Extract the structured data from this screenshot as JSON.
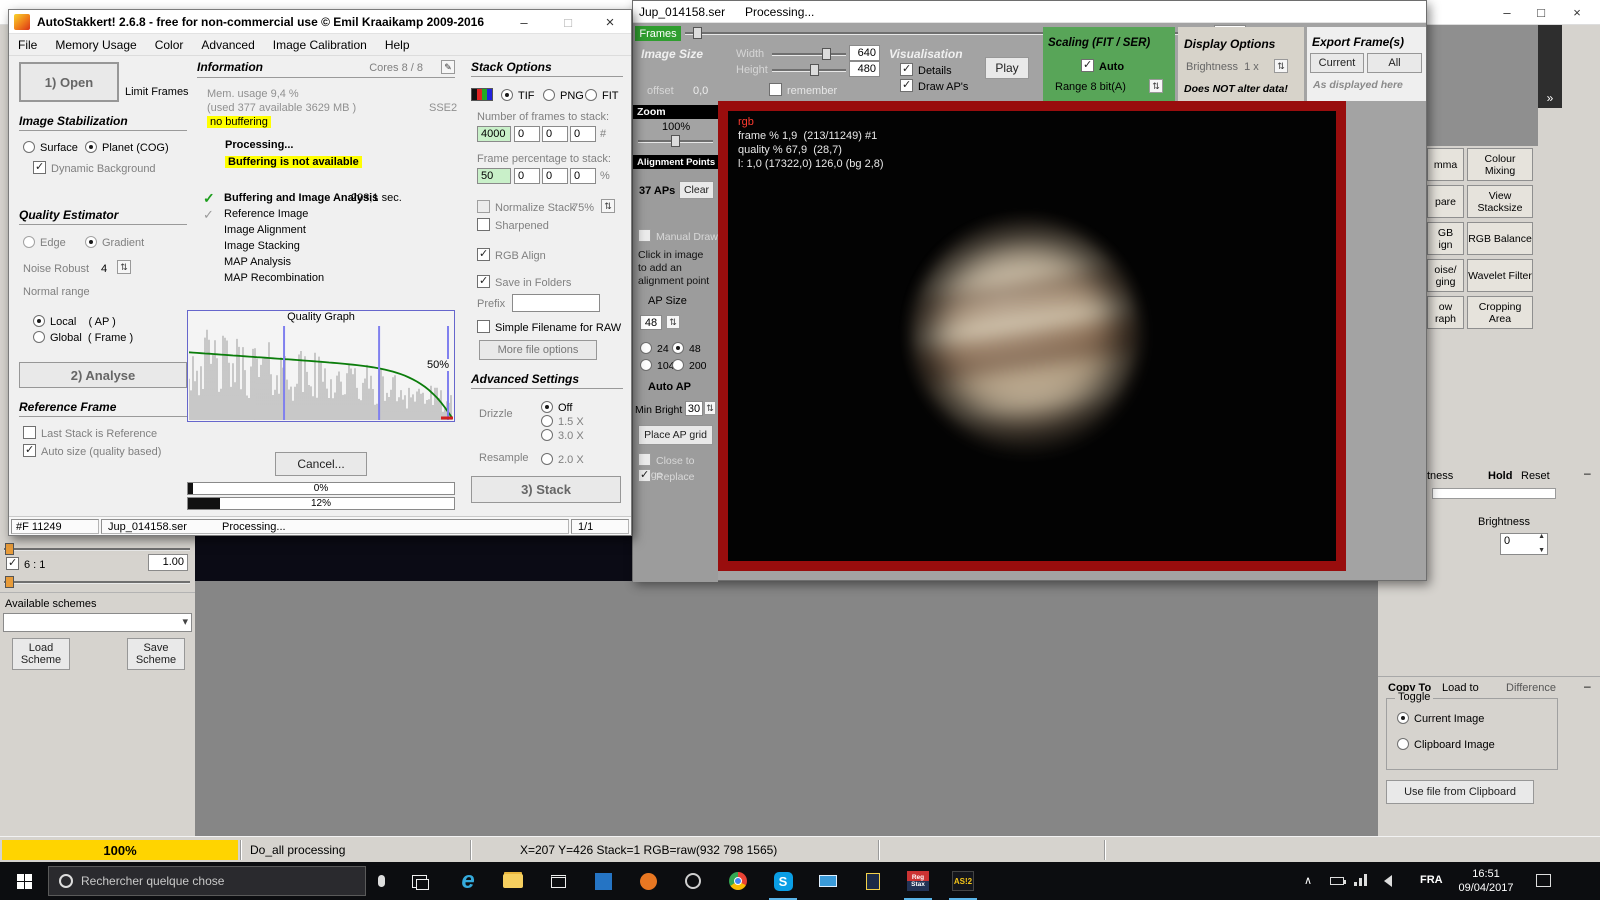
{
  "icons": {
    "minimize": "–",
    "maximize": "□",
    "close": "×",
    "chevron_right": "»",
    "dropdown_arrow": "▾",
    "updown": "⇅",
    "pencil": "✎",
    "tray_chevron": "∧",
    "check": "✓"
  },
  "main_window": {
    "title": "AutoStakkert! 2.6.8 - free for non-commercial use © Emil Kraaikamp 2009-2016",
    "menus": [
      "File",
      "Memory Usage",
      "Color",
      "Advanced",
      "Image Calibration",
      "Help"
    ],
    "open_button": "1) Open",
    "limit_frames": "Limit Frames",
    "stabilization": {
      "title": "Image Stabilization",
      "surface": "Surface",
      "planet": "Planet (COG)",
      "dynamic_background": "Dynamic Background"
    },
    "quality": {
      "title": "Quality Estimator",
      "edge": "Edge",
      "gradient": "Gradient",
      "noise_robust": "Noise Robust",
      "noise_value": "4",
      "normal_range": "Normal range",
      "local": "Local    ( AP )",
      "global": "Global  ( Frame )"
    },
    "analyse_button": "2) Analyse",
    "reference": {
      "title": "Reference Frame",
      "last_stack": "Last Stack is Reference",
      "auto_size": "Auto size (quality based)"
    },
    "info": {
      "title": "Information",
      "cores": "Cores 8 / 8",
      "mem1": "Mem. usage 9,4 %",
      "mem2": "(used 377 available 3629 MB )",
      "sse": "SSE2",
      "nobuf": "no buffering",
      "processing": "Processing...",
      "bufna": "Buffering is not available",
      "steps": [
        {
          "label": "Buffering and Image Analysis",
          "time": "203,1 sec."
        },
        {
          "label": "Reference Image",
          "time": ""
        },
        {
          "label": "Image Alignment",
          "time": ""
        },
        {
          "label": "Image Stacking",
          "time": ""
        },
        {
          "label": "MAP Analysis",
          "time": ""
        },
        {
          "label": "MAP Recombination",
          "time": ""
        }
      ],
      "graph_title": "Quality Graph",
      "graph_pct": "50%",
      "cancel": "Cancel...",
      "p1": "0%",
      "p2": "12%"
    },
    "status": {
      "frames": "#F 11249",
      "file": "Jup_014158.ser",
      "state": "Processing...",
      "page": "1/1"
    },
    "stack": {
      "title": "Stack Options",
      "tif": "TIF",
      "png": "PNG",
      "fit": "FIT",
      "nframes_label": "Number of frames to stack:",
      "nf1": "4000",
      "nf2": "0",
      "nf3": "0",
      "nf4": "0",
      "nf_unit": "#",
      "pct_label": "Frame percentage to stack:",
      "pf1": "50",
      "pf2": "0",
      "pf3": "0",
      "pf4": "0",
      "pf_unit": "%",
      "normalize": "Normalize Stack",
      "normalize_pct": "75%",
      "sharpened": "Sharpened",
      "rgb_align": "RGB Align",
      "save_folders": "Save in Folders",
      "prefix": "Prefix",
      "simple_raw": "Simple Filename for RAW",
      "more_options": "More file options",
      "adv_title": "Advanced Settings",
      "drizzle": "Drizzle",
      "dz_off": "Off",
      "dz_15": "1.5 X",
      "dz_30": "3.0 X",
      "resample": "Resample",
      "rs_20": "2.0 X",
      "stack_button": "3) Stack"
    }
  },
  "frame_window": {
    "title": "Jup_014158.ser",
    "state": "Processing...",
    "frames_label": "Frames",
    "frame_value": "213",
    "size": {
      "title": "Image Size",
      "width": "Width",
      "height": "Height",
      "width_value": "640",
      "height_value": "480",
      "offset_label": "offset",
      "offset_value": "0,0",
      "remember": "remember"
    },
    "vis": {
      "title": "Visualisation",
      "details": "Details",
      "draw_aps": "Draw AP's",
      "play": "Play"
    },
    "scaling": {
      "title": "Scaling (FIT / SER)",
      "auto": "Auto",
      "range": "Range 8 bit(A)"
    },
    "display": {
      "title": "Display Options",
      "brightness": "Brightness  1 x",
      "note": "Does NOT alter data!"
    },
    "export": {
      "title": "Export Frame(s)",
      "current": "Current",
      "all": "All",
      "note": "As displayed here"
    },
    "zoom_title": "Zoom",
    "zoom_value": "100%",
    "ap": {
      "title": "Alignment Points",
      "count": "37 APs",
      "clear": "Clear",
      "manual": "Manual Draw",
      "hint": "Click in image\nto add an\nalignment point",
      "size_label": "AP Size",
      "size_value": "48",
      "s24": "24",
      "s48": "48",
      "s104": "104",
      "s200": "200",
      "auto_ap": "Auto AP",
      "min_bright": "Min Bright",
      "min_bright_value": "30",
      "place_grid": "Place AP grid",
      "close_edge": "Close to Edge",
      "replace": "Replace"
    },
    "overlay": {
      "rgb": "rgb",
      "line1": "frame % 1,9  (213/11249) #1",
      "line2": "quality % 67,9  (28,7)",
      "line3": "l: 1,0 (17322,0) 126,0 (bg 2,8)"
    }
  },
  "registax": {
    "partial_buttons": [
      "mma",
      "pare",
      "GB\nign",
      "oise/\nging",
      "ow\nraph"
    ],
    "buttons": [
      "Colour Mixing",
      "View Stacksize",
      "RGB Balance",
      "Wavelet Filter",
      "Cropping Area"
    ],
    "sharp_partial": "tness",
    "hold": "Hold",
    "reset": "Reset",
    "minimize": "–",
    "brightness": "Brightness",
    "brightness_value": "0",
    "copy_to": "Copy To",
    "load_to": "Load to",
    "difference": "Difference",
    "toggle": "Toggle",
    "current_image": "Current Image",
    "clipboard_image": "Clipboard Image",
    "use_clipboard": "Use file from Clipboard",
    "ratio": "6 : 1",
    "ratio_value": "1.00",
    "schemes": "Available schemes",
    "load_scheme": "Load Scheme",
    "save_scheme": "Save Scheme"
  },
  "statusbar": {
    "progress": "100%",
    "task": "Do_all processing",
    "coords": "X=207 Y=426 Stack=1 RGB=raw(932 798 1565)"
  },
  "taskbar": {
    "search": "Rechercher quelque chose",
    "lang": "FRA",
    "time": "16:51",
    "date": "09/04/2017",
    "edge": "e",
    "skype": "S",
    "registax": "Reg\nStax",
    "as2": "AS!2"
  }
}
